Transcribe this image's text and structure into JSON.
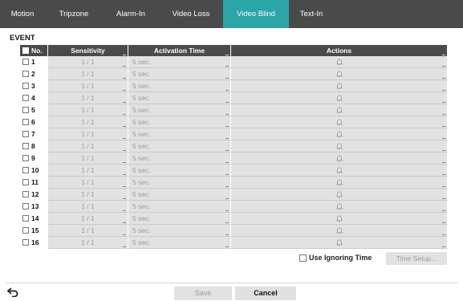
{
  "tabs": [
    "Motion",
    "Tripzone",
    "Alarm-In",
    "Video Loss",
    "Video Blind",
    "Text-In"
  ],
  "active_tab": "Video Blind",
  "section_title": "EVENT",
  "table": {
    "headers": {
      "no": "No.",
      "sensitivity": "Sensitivity",
      "activation_time": "Activation Time",
      "actions": "Actions"
    },
    "rows": [
      {
        "no": "1",
        "sensitivity": "1 / 1",
        "activation_time": "5 sec."
      },
      {
        "no": "2",
        "sensitivity": "1 / 1",
        "activation_time": "5 sec."
      },
      {
        "no": "3",
        "sensitivity": "1 / 1",
        "activation_time": "5 sec."
      },
      {
        "no": "4",
        "sensitivity": "1 / 1",
        "activation_time": "5 sec."
      },
      {
        "no": "5",
        "sensitivity": "1 / 1",
        "activation_time": "5 sec."
      },
      {
        "no": "6",
        "sensitivity": "1 / 1",
        "activation_time": "5 sec."
      },
      {
        "no": "7",
        "sensitivity": "1 / 1",
        "activation_time": "5 sec."
      },
      {
        "no": "8",
        "sensitivity": "1 / 1",
        "activation_time": "5 sec."
      },
      {
        "no": "9",
        "sensitivity": "1 / 1",
        "activation_time": "5 sec."
      },
      {
        "no": "10",
        "sensitivity": "1 / 1",
        "activation_time": "5 sec."
      },
      {
        "no": "11",
        "sensitivity": "1 / 1",
        "activation_time": "5 sec."
      },
      {
        "no": "12",
        "sensitivity": "1 / 1",
        "activation_time": "5 sec."
      },
      {
        "no": "13",
        "sensitivity": "1 / 1",
        "activation_time": "5 sec."
      },
      {
        "no": "14",
        "sensitivity": "1 / 1",
        "activation_time": "5 sec."
      },
      {
        "no": "15",
        "sensitivity": "1 / 1",
        "activation_time": "5 sec."
      },
      {
        "no": "16",
        "sensitivity": "1 / 1",
        "activation_time": "5 sec."
      }
    ],
    "actions_icon": "bell-icon"
  },
  "ignore_time": {
    "label": "Use Ignoring Time",
    "checked": false
  },
  "time_setup_label": "Time Setup...",
  "footer": {
    "back_icon": "back-arrow-icon",
    "save_label": "Save",
    "cancel_label": "Cancel"
  },
  "colors": {
    "tab_bar": "#4a4a4a",
    "active_tab": "#2aa5a8",
    "cell_bg": "#e2e2e2",
    "disabled_text": "#9a9a9a"
  }
}
